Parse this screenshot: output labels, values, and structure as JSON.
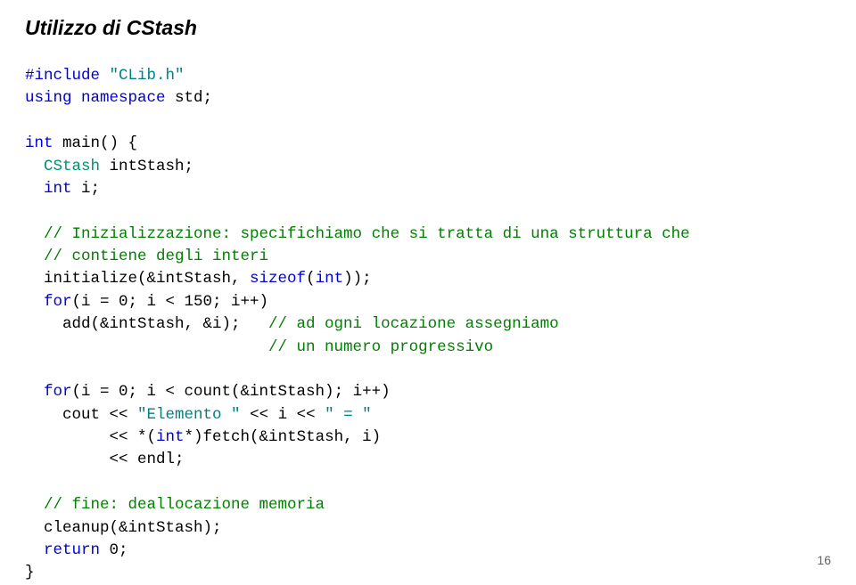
{
  "title": "Utilizzo di CStash",
  "code": {
    "l01a": "#include ",
    "l01b": "\"CLib.h\"",
    "l02a": "using namespace ",
    "l02b": "std;",
    "l04a": "int ",
    "l04b": "main() {",
    "l05a": "  CStash ",
    "l05b": "intStash;",
    "l06a": "  int ",
    "l06b": "i;",
    "l08": "  // Inizializzazione: specifichiamo che si tratta di una struttura che",
    "l09": "  // contiene degli interi",
    "l10a": "  initialize(&intStash, ",
    "l10b": "sizeof",
    "l10c": "(",
    "l10d": "int",
    "l10e": "));",
    "l11a": "  for",
    "l11b": "(i = 0; i < 150; i++)",
    "l12a": "    add(&intStash, &i);   ",
    "l12b": "// ad ogni locazione assegniamo",
    "l13a": "                          ",
    "l13b": "// un numero progressivo",
    "l15a": "  for",
    "l15b": "(i = 0; i < count(&intStash); i++)",
    "l16a": "    cout << ",
    "l16b": "\"Elemento \" ",
    "l16c": "<< i << ",
    "l16d": "\" = \"",
    "l17a": "         << *(",
    "l17b": "int",
    "l17c": "*)fetch(&intStash, i)",
    "l18": "         << endl;",
    "l20": "  // fine: deallocazione memoria",
    "l21": "  cleanup(&intStash);",
    "l22a": "  return ",
    "l22b": "0;",
    "l23": "}"
  },
  "page_number": "16"
}
